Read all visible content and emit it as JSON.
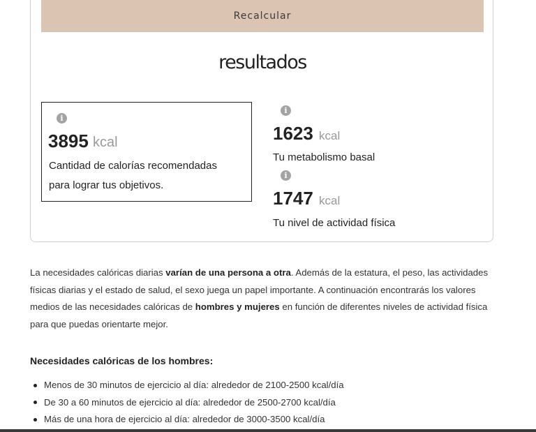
{
  "calculator": {
    "recalculate_label": "Recalcular",
    "results_title": "resultados",
    "recommended": {
      "value": "3895",
      "unit": "kcal",
      "label_line1": "Cantidad de calorías recomendadas",
      "label_line2": "para lograr tus objetivos.",
      "info_icon": "info-icon"
    },
    "basal": {
      "value": "1623",
      "unit": "kcal",
      "label": "Tu metabolismo basal",
      "info_icon": "info-icon"
    },
    "activity": {
      "value": "1747",
      "unit": "kcal",
      "label": "Tu nivel de actividad física",
      "info_icon": "info-icon"
    }
  },
  "article": {
    "intro_part1": "La necesidades calóricas diarias ",
    "intro_bold1": "varían de una persona a otra",
    "intro_part2": ". Además de la estatura, el peso, las actividades físicas diarias y el estado de salud, el sexo juega un papel importante. A continuación encontrarás los valores medios de las necesidades calóricas de ",
    "intro_bold2": "hombres y mujeres",
    "intro_part3": " en función de diferentes niveles de actividad física para que puedas orientarte mejor.",
    "men_heading": "Necesidades calóricas de los hombres:",
    "men_list": [
      "Menos de 30 minutos de ejercicio al día: alrededor de 2100-2500 kcal/día",
      "De 30 a 60 minutos de ejercicio al día: alrededor de 2500-2700 kcal/día",
      "Más de una hora de ejercicio al día: alrededor de 3000-3500 kcal/día"
    ]
  },
  "colors": {
    "button_bg": "#dcc4b3",
    "info_icon": "#a3a3a3",
    "unit_text": "#999999"
  }
}
